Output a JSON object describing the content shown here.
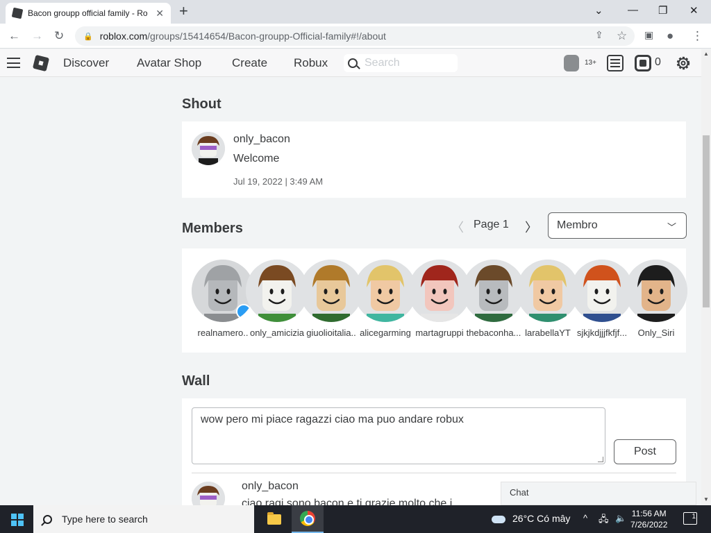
{
  "browser": {
    "tab_title": "Bacon groupp official family - Ro",
    "url_host": "roblox.com",
    "url_path": "/groups/15414654/Bacon-groupp-Official-family#!/about"
  },
  "header": {
    "nav": [
      "Discover",
      "Avatar Shop",
      "Create",
      "Robux"
    ],
    "search_placeholder": "Search",
    "age_label": "13+",
    "robux_count": "0"
  },
  "shout": {
    "title": "Shout",
    "poster": "only_bacon",
    "message": "Welcome",
    "date": "Jul 19, 2022 | 3:49 AM"
  },
  "members": {
    "title": "Members",
    "page_label": "Page 1",
    "role_selected": "Membro",
    "list": [
      {
        "name": "realnamero..",
        "skin": "#b5b8bb",
        "hair": "#9fa2a5",
        "shirt": "#8a8d90",
        "bg": "#d6d8da",
        "verified": true
      },
      {
        "name": "only_amicizia",
        "skin": "#f2f2ee",
        "hair": "#7a4a22",
        "shirt": "#3f8f3a",
        "bg": "#e0e2e4",
        "verified": false
      },
      {
        "name": "giuolioitalia..",
        "skin": "#e8c89a",
        "hair": "#b07a2a",
        "shirt": "#2f6b2f",
        "bg": "#e0e2e4",
        "verified": false
      },
      {
        "name": "alicegarming",
        "skin": "#f0c9a3",
        "hair": "#e2c46a",
        "shirt": "#3fb6a0",
        "bg": "#e0e2e4",
        "verified": false
      },
      {
        "name": "martagruppi",
        "skin": "#f2c6bd",
        "hair": "#a0261c",
        "shirt": "#e6e6e6",
        "bg": "#e0e2e4",
        "verified": false
      },
      {
        "name": "thebaconha...",
        "skin": "#b8bbbe",
        "hair": "#6b4a2a",
        "shirt": "#2f6b3f",
        "bg": "#e0e2e4",
        "verified": false
      },
      {
        "name": "larabellaYT",
        "skin": "#f0c9a3",
        "hair": "#e2c46a",
        "shirt": "#2f8f6f",
        "bg": "#e0e2e4",
        "verified": false
      },
      {
        "name": "sjkjkdjjjfkfjf...",
        "skin": "#f2f2ee",
        "hair": "#d0521c",
        "shirt": "#2f4f8f",
        "bg": "#e0e2e4",
        "verified": false
      },
      {
        "name": "Only_Siri",
        "skin": "#e2b48a",
        "hair": "#1d1d1d",
        "shirt": "#1d1d1d",
        "bg": "#e0e2e4",
        "verified": false
      }
    ]
  },
  "wall": {
    "title": "Wall",
    "draft": "wow pero mi piace ragazzi ciao ma puo andare robux",
    "post_label": "Post",
    "post_author": "only_bacon",
    "post_message": "ciao ragi sono bacon e ti grazie molto che i"
  },
  "chat": {
    "label": "Chat"
  },
  "taskbar": {
    "search_placeholder": "Type here to search",
    "temperature": "26°C",
    "weather_text": "Có mây",
    "time": "11:56 AM",
    "date": "7/26/2022",
    "notification_count": "1"
  },
  "colors": {
    "page_bg": "#f2f4f5",
    "card_bg": "#ffffff",
    "text": "#393b3d",
    "taskbar": "#1f2229"
  }
}
